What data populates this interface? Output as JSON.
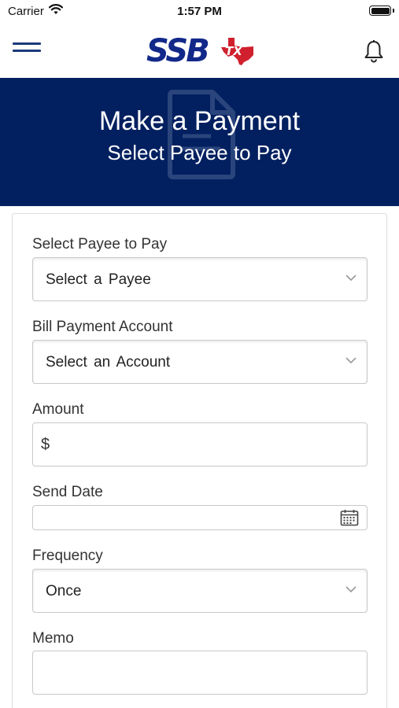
{
  "status_bar": {
    "carrier": "Carrier",
    "time": "1:57 PM",
    "wifi_icon": "wifi-icon",
    "battery_icon": "battery-icon"
  },
  "nav": {
    "menu_icon": "hamburger-menu-icon",
    "logo_text": "SSB",
    "logo_badge": "TX",
    "bell_icon": "bell-icon"
  },
  "hero": {
    "title": "Make a Payment",
    "subtitle": "Select Payee to Pay",
    "background_icon": "document-icon",
    "background_color": "#022060"
  },
  "form": {
    "payee": {
      "label": "Select Payee to Pay",
      "selected": "Select a Payee"
    },
    "account": {
      "label": "Bill Payment Account",
      "selected": "Select an Account"
    },
    "amount": {
      "label": "Amount",
      "prefix": "$",
      "value": ""
    },
    "send_date": {
      "label": "Send Date",
      "value": "",
      "icon": "calendar-icon"
    },
    "frequency": {
      "label": "Frequency",
      "selected": "Once"
    },
    "memo": {
      "label": "Memo",
      "value": ""
    }
  },
  "colors": {
    "brand_blue": "#12298a",
    "brand_red": "#d0202e",
    "hero_navy": "#022060"
  }
}
